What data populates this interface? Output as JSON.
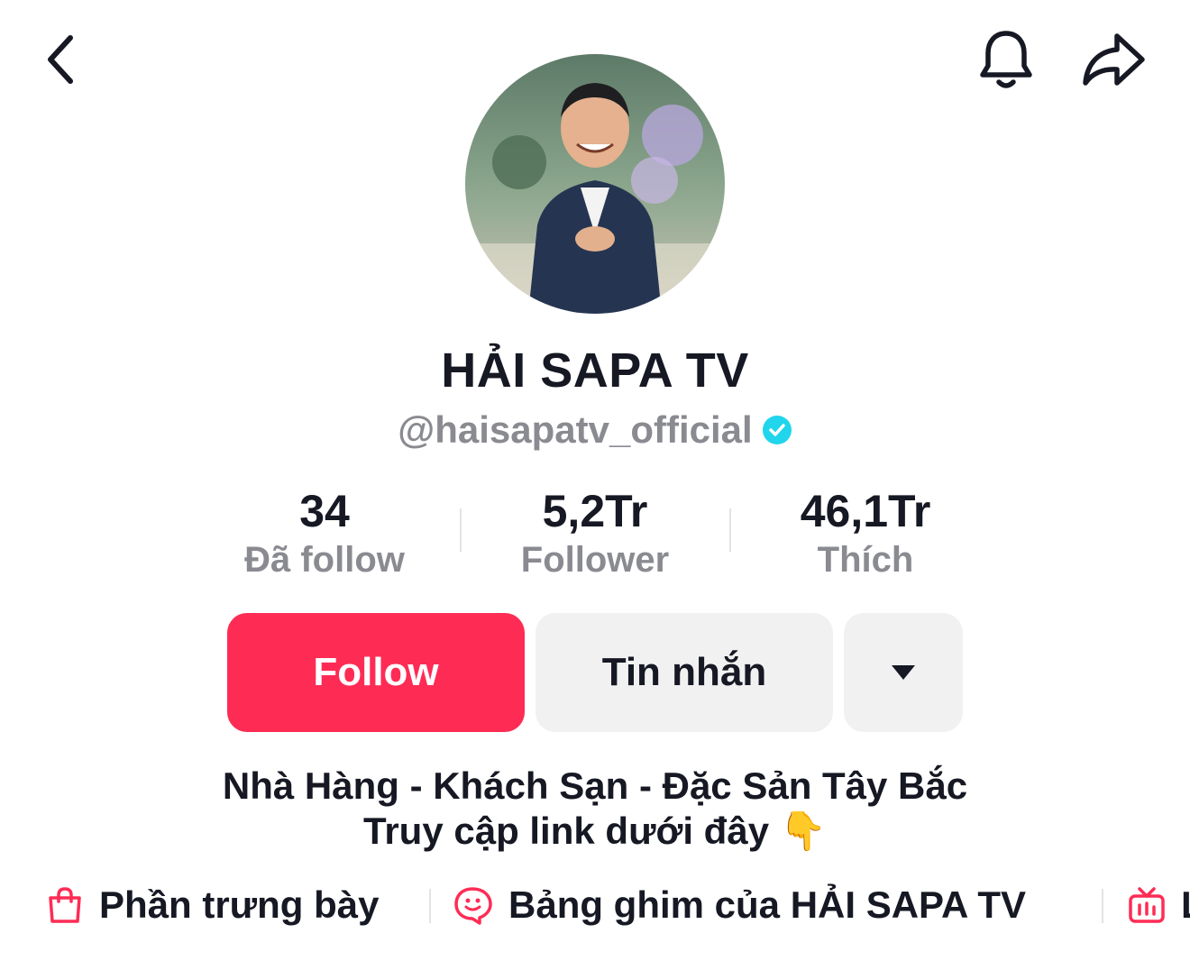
{
  "profile": {
    "display_name": "HẢI SAPA TV",
    "handle": "@haisapatv_official"
  },
  "stats": [
    {
      "value": "34",
      "label": "Đã follow"
    },
    {
      "value": "5,2Tr",
      "label": "Follower"
    },
    {
      "value": "46,1Tr",
      "label": "Thích"
    }
  ],
  "actions": {
    "follow_label": "Follow",
    "message_label": "Tin nhắn"
  },
  "bio": {
    "line1": "Nhà Hàng - Khách Sạn - Đặc Sản Tây Bắc",
    "line2": "Truy cập link dưới đây 👇"
  },
  "links": [
    {
      "label": "Phần trưng bày",
      "icon": "shopping-bag-icon"
    },
    {
      "label": "Bảng ghim của HẢI SAPA TV",
      "icon": "pin-board-icon"
    },
    {
      "label": "L",
      "icon": "live-tv-icon"
    }
  ],
  "colors": {
    "accent": "#fe2c55",
    "verified": "#20d5ec",
    "muted_text": "#8a8b91",
    "button_gray": "#f1f1f2"
  },
  "icons": {
    "back": "chevron-left-icon",
    "notifications": "bell-icon",
    "share": "share-arrow-icon",
    "more": "caret-down-icon"
  }
}
